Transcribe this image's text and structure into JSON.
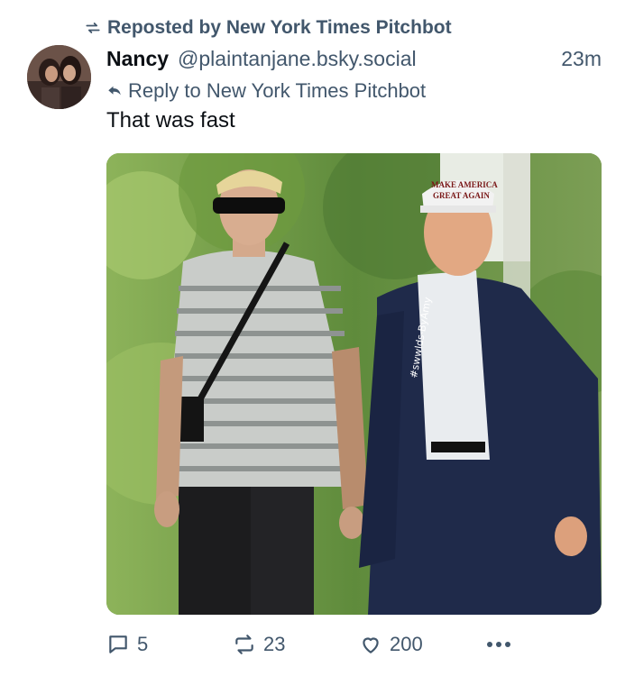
{
  "repost_banner": {
    "text": "Reposted by New York Times Pitchbot",
    "icon": "repost-icon"
  },
  "author": {
    "display_name": "Nancy",
    "handle": "@plaintanjane.bsky.social",
    "avatar": "avatar-photo"
  },
  "timestamp": "23m",
  "reply_context": {
    "text": "Reply to New York Times Pitchbot",
    "icon": "reply-arrow-icon"
  },
  "post": {
    "text": "That was fast"
  },
  "media": {
    "type": "photo",
    "cap_text_line1": "MAKE AMERICA",
    "cap_text_line2": "GREAT AGAIN",
    "watermark": "#swwlds-ByAmy"
  },
  "actions": {
    "replies": "5",
    "reposts": "23",
    "likes": "200"
  },
  "colors": {
    "muted": "#42576c",
    "text": "#0b0f14",
    "background": "#ffffff"
  }
}
